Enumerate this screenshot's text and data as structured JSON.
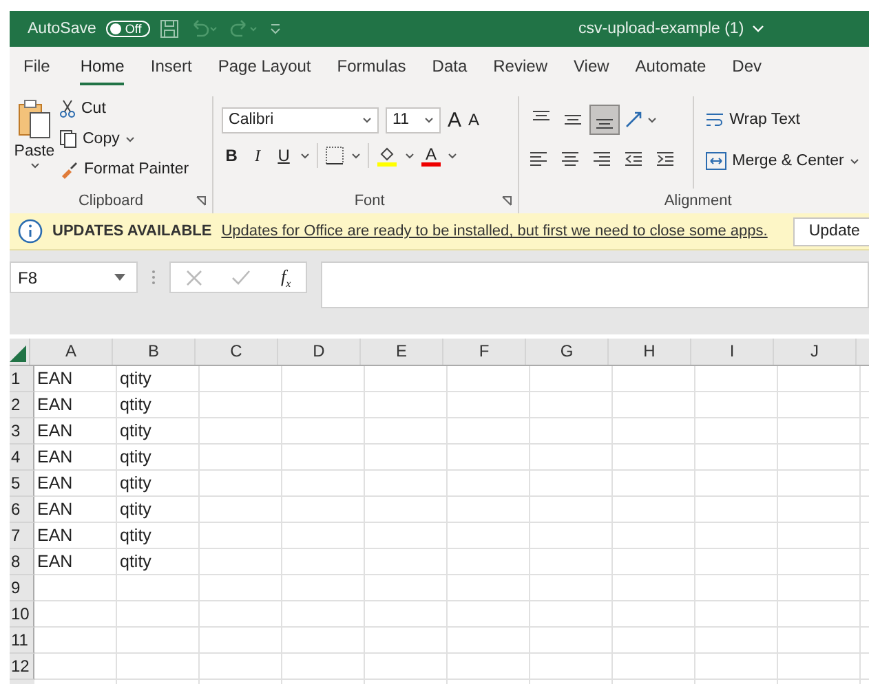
{
  "title_bar": {
    "autosave_label": "AutoSave",
    "autosave_toggle": {
      "label": "Off",
      "on": false
    },
    "document_title": "csv-upload-example (1)"
  },
  "tabs": [
    {
      "label": "File",
      "selected": false
    },
    {
      "label": "Home",
      "selected": true
    },
    {
      "label": "Insert",
      "selected": false
    },
    {
      "label": "Page Layout",
      "selected": false
    },
    {
      "label": "Formulas",
      "selected": false
    },
    {
      "label": "Data",
      "selected": false
    },
    {
      "label": "Review",
      "selected": false
    },
    {
      "label": "View",
      "selected": false
    },
    {
      "label": "Automate",
      "selected": false
    },
    {
      "label": "Dev",
      "selected": false
    }
  ],
  "ribbon": {
    "clipboard": {
      "paste": "Paste",
      "cut": "Cut",
      "copy": "Copy",
      "format_painter": "Format Painter",
      "label": "Clipboard"
    },
    "font": {
      "font_name": "Calibri",
      "font_size": "11",
      "grow": "A",
      "shrink": "A",
      "bold": "B",
      "italic": "I",
      "underline": "U",
      "font_color": "A",
      "label": "Font"
    },
    "alignment": {
      "vertical": [
        {
          "selected": false
        },
        {
          "selected": false
        },
        {
          "selected": true
        }
      ],
      "wrap_text": "Wrap Text",
      "merge_center": "Merge & Center",
      "label": "Alignment"
    }
  },
  "message_bar": {
    "title": "UPDATES AVAILABLE",
    "message": "Updates for Office are ready to be installed, but first we need to close some apps.",
    "button": "Update"
  },
  "formula_bar": {
    "name_box": "F8",
    "function": "f$_{x}$"
  },
  "sheet": {
    "columns": [
      "A",
      "B",
      "C",
      "D",
      "E",
      "F",
      "G",
      "H",
      "I",
      "J"
    ],
    "rows": [
      {
        "number": "1",
        "cells": [
          "EAN",
          "qtity"
        ]
      },
      {
        "number": "2",
        "cells": [
          "EAN",
          "qtity"
        ]
      },
      {
        "number": "3",
        "cells": [
          "EAN",
          "qtity"
        ]
      },
      {
        "number": "4",
        "cells": [
          "EAN",
          "qtity"
        ]
      },
      {
        "number": "5",
        "cells": [
          "EAN",
          "qtity"
        ]
      },
      {
        "number": "6",
        "cells": [
          "EAN",
          "qtity"
        ]
      },
      {
        "number": "7",
        "cells": [
          "EAN",
          "qtity"
        ]
      },
      {
        "number": "8",
        "cells": [
          "EAN",
          "qtity"
        ]
      },
      {
        "number": "9"
      },
      {
        "number": "10"
      },
      {
        "number": "11"
      },
      {
        "number": "12"
      }
    ]
  }
}
